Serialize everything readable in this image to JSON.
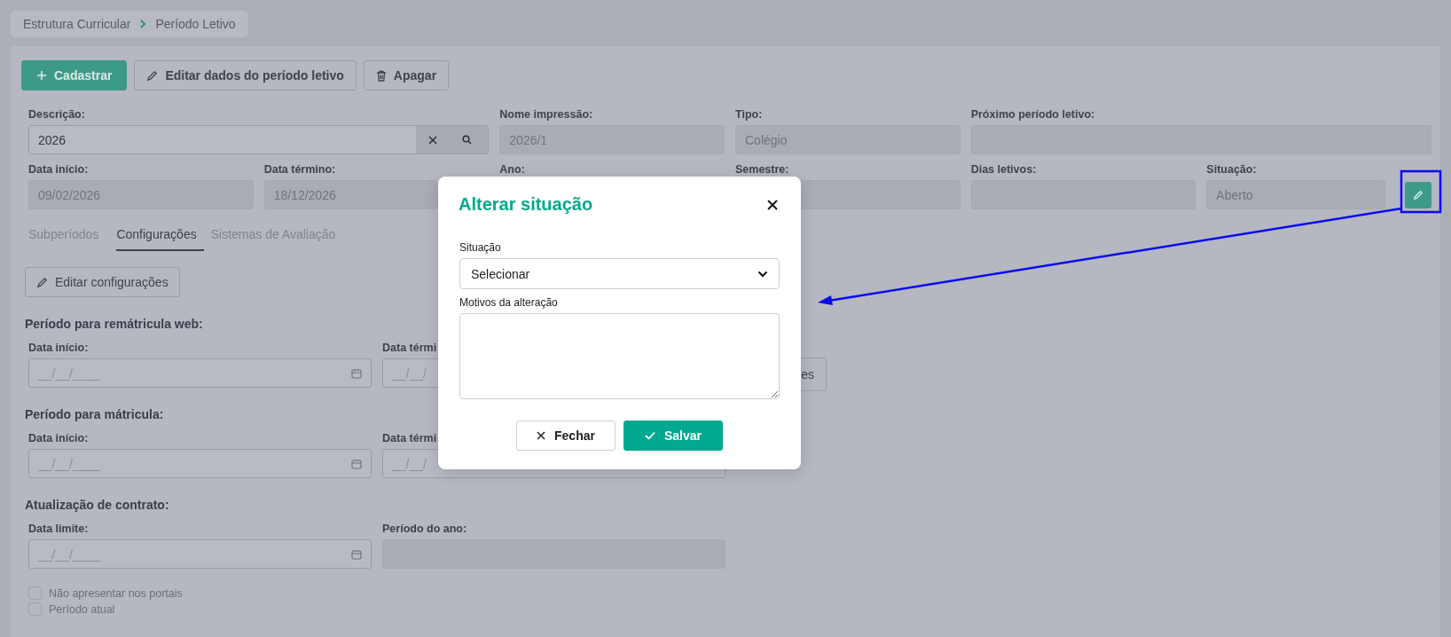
{
  "breadcrumb": [
    {
      "label": "Estrutura Curricular"
    },
    {
      "label": "Período Letivo"
    }
  ],
  "toolbar": [
    {
      "label": "Cadastrar",
      "kind": "add"
    },
    {
      "label": "Editar dados do período letivo",
      "kind": "edit"
    },
    {
      "label": "Apagar",
      "kind": "delete"
    }
  ],
  "form_rows": [
    [
      {
        "label": "Descrição:",
        "value": "2026",
        "kind": "lookup",
        "disabled": false
      },
      {
        "label": "Nome impressão:",
        "value": "2026/1",
        "kind": "text",
        "disabled": true
      },
      {
        "label": "Tipo:",
        "value": "Colégio",
        "kind": "text",
        "disabled": true
      },
      {
        "label": "Próximo período letivo:",
        "kind": "text",
        "disabled": true
      }
    ],
    [
      {
        "label": "Data início:",
        "value": "09/02/2026",
        "kind": "text",
        "disabled": true
      },
      {
        "label": "Data término:",
        "value": "18/12/2026",
        "kind": "text",
        "disabled": true
      },
      {
        "label": "Ano:"
      },
      {
        "label": "Semestre:",
        "kind": "text",
        "disabled": true
      },
      {
        "label": "Dias letivos:",
        "kind": "text",
        "disabled": true
      },
      {
        "label": "Situação:",
        "value": "Aberto",
        "kind": "status",
        "disabled": true
      }
    ]
  ],
  "tabs": [
    {
      "label": "Subperíodos",
      "selected": false
    },
    {
      "label": "Configurações",
      "selected": true
    },
    {
      "label": "Sistemas de Avaliação",
      "selected": false
    }
  ],
  "edit_config_button": "Editar configurações",
  "sections": [
    {
      "title": "Período para remátricula web:",
      "fields": [
        {
          "label": "Data início:",
          "placeholder": "__/__/____",
          "kind": "date"
        },
        {
          "label": "Data térmi",
          "placeholder": "__/__/",
          "kind": "date_partial"
        }
      ],
      "extra_button": "es"
    },
    {
      "title": "Período para mátricula:",
      "fields": [
        {
          "label": "Data início:",
          "placeholder": "__/__/____",
          "kind": "date"
        },
        {
          "label": "Data térmi",
          "placeholder": "__/__/",
          "kind": "date_partial"
        }
      ]
    },
    {
      "title": "Atualização de contrato:",
      "fields": [
        {
          "label": "Data limite:",
          "placeholder": "__/__/____",
          "kind": "date"
        },
        {
          "label": "Período do ano:",
          "kind": "text"
        }
      ]
    }
  ],
  "checkboxes": [
    {
      "label": "Não apresentar nos portais",
      "checked": false
    },
    {
      "label": "Período atual",
      "checked": false
    }
  ],
  "modal": {
    "title": "Alterar situação",
    "fields": [
      {
        "label": "Situação",
        "kind": "select",
        "value": "Selecionar"
      },
      {
        "label": "Motivos da alteração",
        "kind": "textarea"
      }
    ],
    "buttons": [
      {
        "label": "Fechar",
        "kind": "secondary"
      },
      {
        "label": "Salvar",
        "kind": "primary"
      }
    ]
  }
}
